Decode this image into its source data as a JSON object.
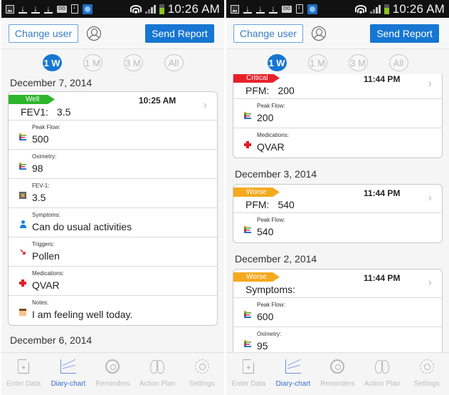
{
  "status_bar": {
    "time": "10:26 AM",
    "icons": [
      "image-icon",
      "download-icon",
      "download-icon",
      "download-icon",
      "voicemail-icon",
      "device-download-icon",
      "app-icon",
      "wifi-icon",
      "signal-icon",
      "battery-icon"
    ]
  },
  "toolbar": {
    "change_user_label": "Change user",
    "send_report_label": "Send Report"
  },
  "ranges": [
    {
      "label": "1 W",
      "active": true
    },
    {
      "label": "1 M",
      "active": false
    },
    {
      "label": "3 M",
      "active": false
    },
    {
      "label": "All",
      "active": false
    }
  ],
  "tabs": [
    {
      "label": "Enter Data",
      "icon": "document-add-icon",
      "active": false
    },
    {
      "label": "Diary-chart",
      "icon": "line-chart-icon",
      "active": true
    },
    {
      "label": "Reminders",
      "icon": "alarm-clock-icon",
      "active": false
    },
    {
      "label": "Action Plan",
      "icon": "lungs-icon",
      "active": false
    },
    {
      "label": "Settings",
      "icon": "gear-icon",
      "active": false
    }
  ],
  "status_colors": {
    "Well": "#2db52d",
    "Critical": "#e8202a",
    "Worse": "#f5a91d"
  },
  "left_screen": {
    "date1": "December 7, 2014",
    "card1": {
      "status": "Well",
      "time": "10:25 AM",
      "summary_label": "FEV1:",
      "summary_value": "3.5",
      "rows": [
        {
          "label": "Peak Flow:",
          "value": "500",
          "icon": "chart-icon"
        },
        {
          "label": "Oximetry:",
          "value": "98",
          "icon": "chart-icon"
        },
        {
          "label": "FEV-1:",
          "value": "3.5",
          "icon": "fev-icon"
        },
        {
          "label": "Symptoms:",
          "value": "Can do usual activities",
          "icon": "person-icon"
        },
        {
          "label": "Triggers:",
          "value": "Pollen",
          "icon": "trigger-arrow-icon"
        },
        {
          "label": "Medications:",
          "value": "QVAR",
          "icon": "medical-cross-icon"
        },
        {
          "label": "Notes:",
          "value": "I am feeling well today.",
          "icon": "notes-icon"
        }
      ]
    },
    "date2": "December 6, 2014"
  },
  "right_screen": {
    "card1": {
      "status": "Critical",
      "time": "11:44 PM",
      "summary_label": "PFM:",
      "summary_value": "200",
      "rows": [
        {
          "label": "Peak Flow:",
          "value": "200",
          "icon": "chart-icon"
        },
        {
          "label": "Medications:",
          "value": "QVAR",
          "icon": "medical-cross-icon"
        }
      ]
    },
    "date2": "December 3, 2014",
    "card2": {
      "status": "Worse",
      "time": "11:44 PM",
      "summary_label": "PFM:",
      "summary_value": "540",
      "rows": [
        {
          "label": "Peak Flow:",
          "value": "540",
          "icon": "chart-icon"
        }
      ]
    },
    "date3": "December 2, 2014",
    "card3": {
      "status": "Worse",
      "time": "11:44 PM",
      "summary_label": "Symptoms:",
      "summary_value": "",
      "rows": [
        {
          "label": "Peak Flow:",
          "value": "600",
          "icon": "chart-icon"
        },
        {
          "label": "Oximetry:",
          "value": "95",
          "icon": "chart-icon"
        }
      ]
    }
  }
}
